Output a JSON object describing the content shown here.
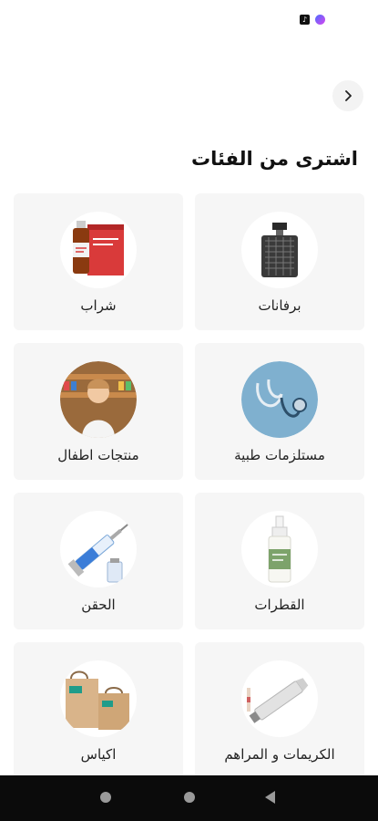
{
  "header": {
    "title": "اشترى من الفئات"
  },
  "categories": [
    {
      "label": "برفانات",
      "icon": "perfume-bottle-icon"
    },
    {
      "label": "شراب",
      "icon": "syrup-bottle-icon"
    },
    {
      "label": "مستلزمات طبية",
      "icon": "stethoscope-icon"
    },
    {
      "label": "منتجات اطفال",
      "icon": "child-pharmacist-icon"
    },
    {
      "label": "القطرات",
      "icon": "eye-drops-icon"
    },
    {
      "label": "الحقن",
      "icon": "syringe-icon"
    },
    {
      "label": "الكريمات و المراهم",
      "icon": "ointment-tube-icon"
    },
    {
      "label": "اكياس",
      "icon": "paper-bags-icon"
    }
  ],
  "colors": {
    "card_bg": "#f6f6f6",
    "nav_bg": "#0b0b0b",
    "accent_bag": "#1f9c8a"
  }
}
